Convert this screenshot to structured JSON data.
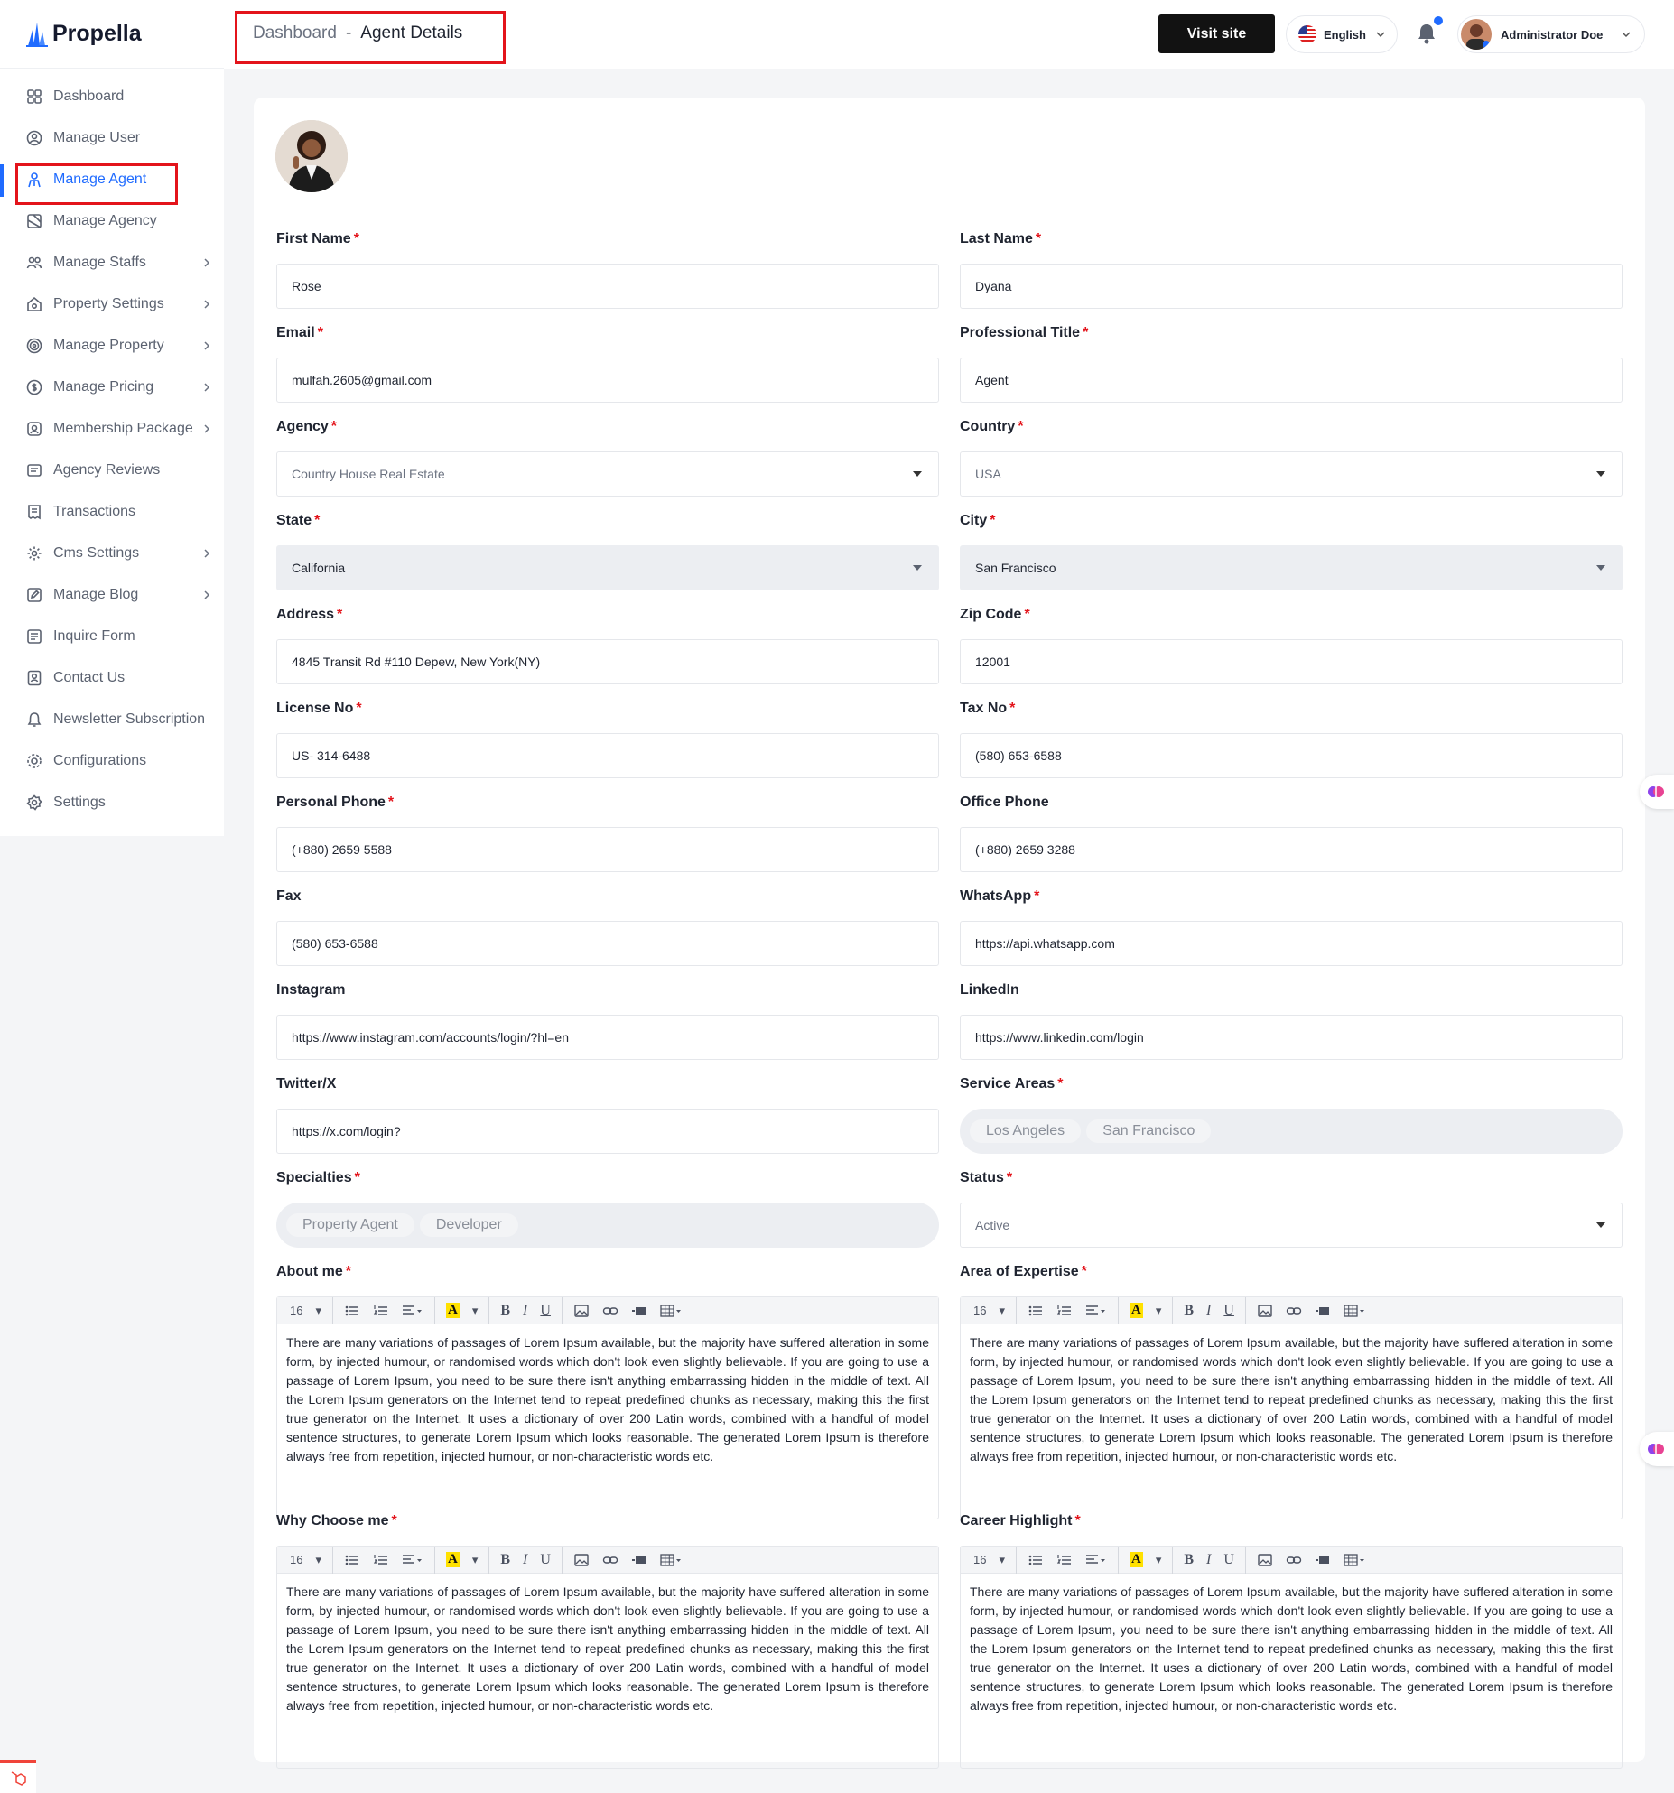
{
  "brand": {
    "name": "Propella"
  },
  "sidebar": {
    "items": [
      {
        "label": "Dashboard",
        "icon": "grid-icon",
        "chevron": false
      },
      {
        "label": "Manage User",
        "icon": "user-circle-icon",
        "chevron": false
      },
      {
        "label": "Manage Agent",
        "icon": "agent-icon",
        "chevron": false,
        "active": true
      },
      {
        "label": "Manage Agency",
        "icon": "agency-icon",
        "chevron": false
      },
      {
        "label": "Manage Staffs",
        "icon": "users-icon",
        "chevron": true
      },
      {
        "label": "Property Settings",
        "icon": "house-gear-icon",
        "chevron": true
      },
      {
        "label": "Manage Property",
        "icon": "target-icon",
        "chevron": true
      },
      {
        "label": "Manage Pricing",
        "icon": "dollar-circle-icon",
        "chevron": true
      },
      {
        "label": "Membership Package",
        "icon": "badge-icon",
        "chevron": true
      },
      {
        "label": "Agency Reviews",
        "icon": "review-icon",
        "chevron": false
      },
      {
        "label": "Transactions",
        "icon": "receipt-icon",
        "chevron": false
      },
      {
        "label": "Cms Settings",
        "icon": "gear-icon",
        "chevron": true
      },
      {
        "label": "Manage Blog",
        "icon": "edit-icon",
        "chevron": true
      },
      {
        "label": "Inquire Form",
        "icon": "list-icon",
        "chevron": false
      },
      {
        "label": "Contact Us",
        "icon": "contact-icon",
        "chevron": false
      },
      {
        "label": "Newsletter Subscription",
        "icon": "bell-icon",
        "chevron": false
      },
      {
        "label": "Configurations",
        "icon": "cog-icon",
        "chevron": false
      },
      {
        "label": "Settings",
        "icon": "settings-icon",
        "chevron": false
      }
    ]
  },
  "header": {
    "breadcrumb_root": "Dashboard",
    "breadcrumb_sep": "-",
    "breadcrumb_current": "Agent Details",
    "visit_label": "Visit site",
    "language": "English",
    "user_name": "Administrator Doe"
  },
  "form": {
    "first_name": {
      "label": "First Name",
      "value": "Rose",
      "required": true
    },
    "last_name": {
      "label": "Last Name",
      "value": "Dyana",
      "required": true
    },
    "email": {
      "label": "Email",
      "value": "mulfah.2605@gmail.com",
      "required": true
    },
    "professional_title": {
      "label": "Professional Title",
      "value": "Agent",
      "required": true
    },
    "agency": {
      "label": "Agency",
      "value": "Country House Real Estate",
      "required": true
    },
    "country": {
      "label": "Country",
      "value": "USA",
      "required": true
    },
    "state": {
      "label": "State",
      "value": "California",
      "required": true
    },
    "city": {
      "label": "City",
      "value": "San Francisco",
      "required": true
    },
    "address": {
      "label": "Address",
      "value": "4845 Transit Rd #110 Depew, New York(NY)",
      "required": true
    },
    "zip": {
      "label": "Zip Code",
      "value": "12001",
      "required": true
    },
    "license": {
      "label": "License No",
      "value": "US- 314-6488",
      "required": true
    },
    "tax": {
      "label": "Tax No",
      "value": "(580) 653-6588",
      "required": true
    },
    "personal_phone": {
      "label": "Personal Phone",
      "value": "(+880) 2659 5588",
      "required": true
    },
    "office_phone": {
      "label": "Office Phone",
      "value": "(+880) 2659 3288",
      "required": false
    },
    "fax": {
      "label": "Fax",
      "value": "(580) 653-6588",
      "required": false
    },
    "whatsapp": {
      "label": "WhatsApp",
      "value": "https://api.whatsapp.com",
      "required": true
    },
    "instagram": {
      "label": "Instagram",
      "value": "https://www.instagram.com/accounts/login/?hl=en",
      "required": false
    },
    "linkedin": {
      "label": "LinkedIn",
      "value": "https://www.linkedin.com/login",
      "required": false
    },
    "twitter": {
      "label": "Twitter/X",
      "value": "https://x.com/login?",
      "required": false
    },
    "service_areas": {
      "label": "Service Areas",
      "tags": [
        "Los Angeles",
        "San Francisco"
      ],
      "required": true
    },
    "specialties": {
      "label": "Specialties",
      "tags": [
        "Property Agent",
        "Developer"
      ],
      "required": true
    },
    "status": {
      "label": "Status",
      "value": "Active",
      "required": true
    },
    "about_me": {
      "label": "About me",
      "required": true
    },
    "area_expertise": {
      "label": "Area of Expertise",
      "required": true
    },
    "why_choose": {
      "label": "Why Choose me",
      "required": true
    },
    "career": {
      "label": "Career Highlight",
      "required": true
    }
  },
  "editor": {
    "font_size": "16",
    "body_text": "There are many variations of passages of Lorem Ipsum available, but the majority have suffered alteration in some form, by injected humour, or randomised words which don't look even slightly believable. If you are going to use a passage of Lorem Ipsum, you need to be sure there isn't anything embarrassing hidden in the middle of text. All the Lorem Ipsum generators on the Internet tend to repeat predefined chunks as necessary, making this the first true generator on the Internet. It uses a dictionary of over 200 Latin words, combined with a handful of model sentence structures, to generate Lorem Ipsum which looks reasonable. The generated Lorem Ipsum is therefore always free from repetition, injected humour, or non-characteristic words etc.",
    "bold": "B",
    "italic": "I",
    "underline": "U",
    "highlight": "A"
  },
  "required_mark": "*",
  "colors": {
    "accent": "#1f6bff",
    "required": "#e3141b",
    "highlight_box": "#e3141b"
  }
}
